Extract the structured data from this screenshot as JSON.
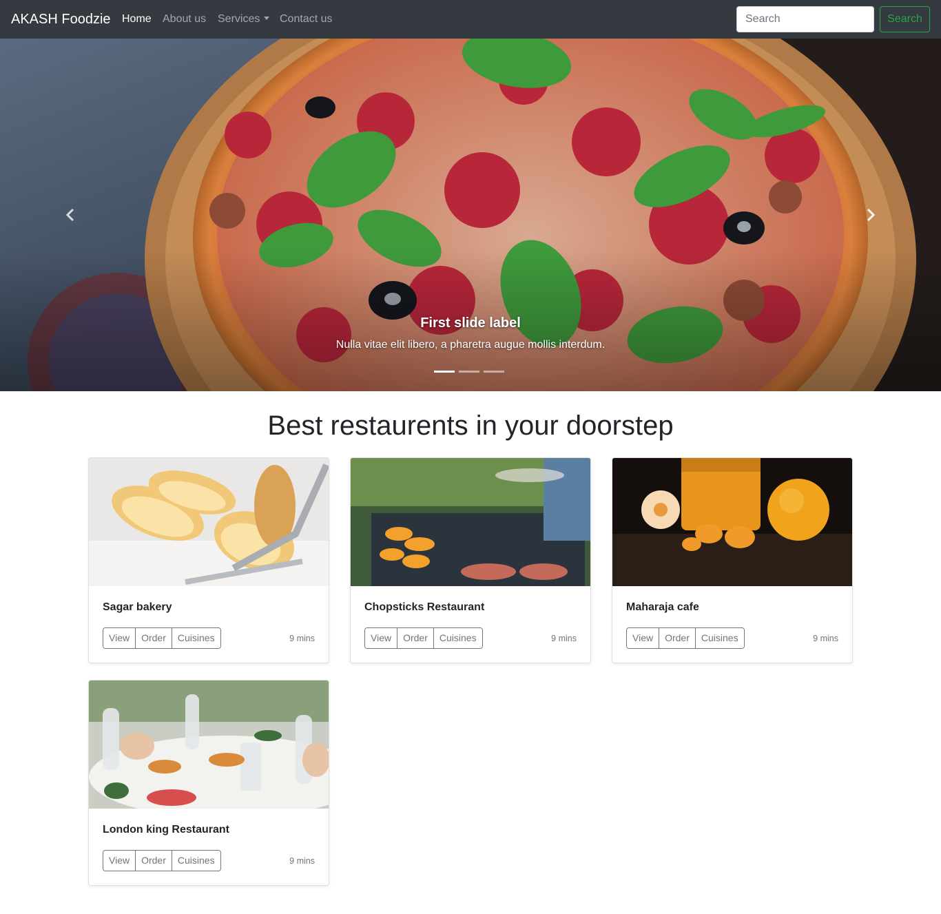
{
  "navbar": {
    "brand": "AKASH Foodzie",
    "links": [
      {
        "label": "Home",
        "active": true
      },
      {
        "label": "About us"
      },
      {
        "label": "Services",
        "dropdown": true
      },
      {
        "label": "Contact us"
      }
    ],
    "search": {
      "placeholder": "Search",
      "button_label": "Search"
    },
    "colors": {
      "background": "#343a40",
      "search_button": "#28a745"
    }
  },
  "carousel": {
    "caption_title": "First slide label",
    "caption_text": "Nulla vitae elit libero, a pharetra augue mollis interdum.",
    "indicators": 3,
    "active_indicator": 0,
    "prev_icon": "chevron-left-icon",
    "next_icon": "chevron-right-icon"
  },
  "section": {
    "title": "Best restaurents in your doorstep"
  },
  "restaurants": [
    {
      "name": "Sagar bakery",
      "time": "9 mins",
      "buttons": [
        "View",
        "Order",
        "Cuisines"
      ]
    },
    {
      "name": "Chopsticks Restaurant",
      "time": "9 mins",
      "buttons": [
        "View",
        "Order",
        "Cuisines"
      ]
    },
    {
      "name": "Maharaja cafe",
      "time": "9 mins",
      "buttons": [
        "View",
        "Order",
        "Cuisines"
      ]
    },
    {
      "name": "London king Restaurant",
      "time": "9 mins",
      "buttons": [
        "View",
        "Order",
        "Cuisines"
      ]
    }
  ]
}
